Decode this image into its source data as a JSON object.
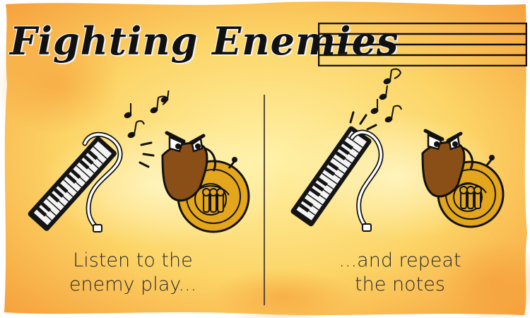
{
  "title": "Fighting Enemies",
  "captions": {
    "left": [
      "Listen to the",
      "enemy play..."
    ],
    "right": [
      "...and repeat",
      "the notes"
    ]
  },
  "colors": {
    "background_light": "#fff3b0",
    "background_orange": "#f7a43a",
    "horn_gold": "#e0a21a",
    "horn_bell": "#8a4f16",
    "keyboard": "#151515",
    "staff_lines": "#111111"
  },
  "icons": [
    "music-note-icon",
    "keytar-icon",
    "french-horn-enemy-icon",
    "music-staff-icon"
  ]
}
